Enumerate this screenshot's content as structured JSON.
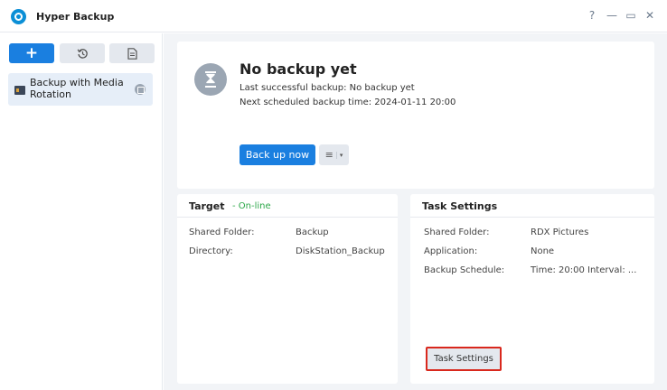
{
  "app": {
    "title": "Hyper Backup"
  },
  "window": {
    "help": "?",
    "minimize": "—",
    "maximize": "▭",
    "close": "✕"
  },
  "sidebar": {
    "add_label": "+",
    "task": {
      "label": "Backup with Media Rotation"
    }
  },
  "status": {
    "title": "No backup yet",
    "last_backup": "Last successful backup: No backup yet",
    "next_backup": "Next scheduled backup time: 2024-01-11 20:00",
    "backup_now": "Back up now",
    "menu_icon": "≡",
    "caret": "▾"
  },
  "target": {
    "title": "Target",
    "state": "- On-line",
    "rows": [
      {
        "label": "Shared Folder:",
        "value": "Backup"
      },
      {
        "label": "Directory:",
        "value": "DiskStation_Backup"
      }
    ]
  },
  "task_settings": {
    "title": "Task Settings",
    "rows": [
      {
        "label": "Shared Folder:",
        "value": "RDX Pictures"
      },
      {
        "label": "Application:",
        "value": "None"
      },
      {
        "label": "Backup Schedule:",
        "value": "Time: 20:00 Interval: ..."
      }
    ],
    "button": "Task Settings"
  },
  "colors": {
    "accent": "#1a7fe0",
    "online": "#2da84a",
    "highlight": "#d9281d"
  }
}
